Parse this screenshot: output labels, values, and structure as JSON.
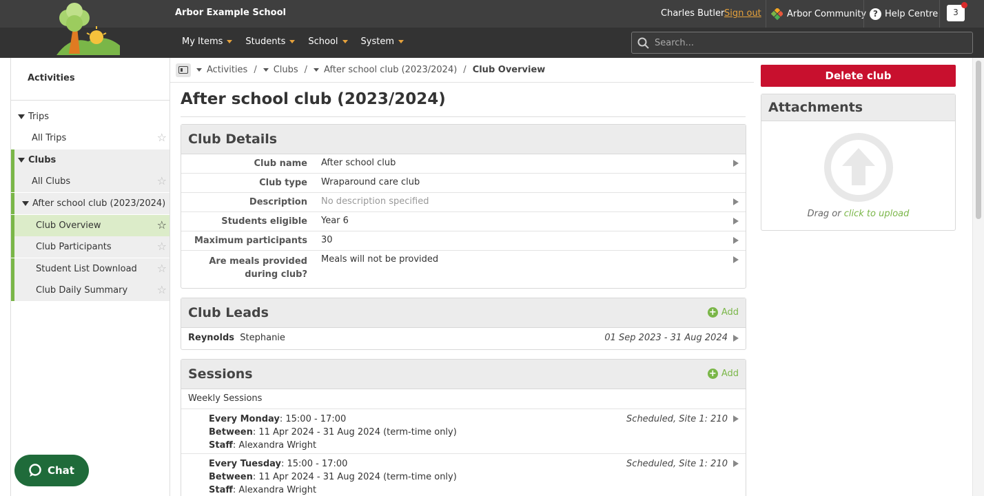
{
  "header": {
    "school_name": "Arbor Example School",
    "user_name": "Charles Butler",
    "sign_out": "Sign out",
    "community": "Arbor Community",
    "help": "Help Centre",
    "notification_count": "3",
    "nav": [
      "My Items",
      "Students",
      "School",
      "System"
    ],
    "search_placeholder": "Search..."
  },
  "sidebar": {
    "title": "Activities",
    "items": [
      {
        "label": "Trips"
      },
      {
        "label": "All Trips"
      },
      {
        "label": "Clubs"
      },
      {
        "label": "All Clubs"
      },
      {
        "label": "After school club (2023/2024)"
      },
      {
        "label": "Club Overview"
      },
      {
        "label": "Club Participants"
      },
      {
        "label": "Student List Download"
      },
      {
        "label": "Club Daily Summary"
      }
    ]
  },
  "breadcrumb": {
    "items": [
      "Activities",
      "Clubs",
      "After school club (2023/2024)"
    ],
    "current": "Club Overview"
  },
  "page": {
    "title": "After school club (2023/2024)"
  },
  "club_details": {
    "heading": "Club Details",
    "rows": [
      {
        "label": "Club name",
        "value": "After school club"
      },
      {
        "label": "Club type",
        "value": "Wraparound care club"
      },
      {
        "label": "Description",
        "value": "No description specified"
      },
      {
        "label": "Students eligible",
        "value": "Year 6"
      },
      {
        "label": "Maximum participants",
        "value": "30"
      },
      {
        "label": "Are meals provided during club?",
        "value": "Meals will not be provided"
      }
    ]
  },
  "club_leads": {
    "heading": "Club Leads",
    "add_label": "Add",
    "rows": [
      {
        "surname": "Reynolds",
        "forename": "Stephanie",
        "dates": "01 Sep 2023 - 31 Aug 2024"
      }
    ]
  },
  "sessions": {
    "heading": "Sessions",
    "add_label": "Add",
    "subheading": "Weekly Sessions",
    "rows": [
      {
        "day": "Every Monday",
        "time": ": 15:00 - 17:00",
        "between_label": "Between",
        "between": ": 11 Apr 2024 - 31 Aug 2024 (term-time only)",
        "staff_label": "Staff",
        "staff": ": Alexandra Wright",
        "meta": "Scheduled, Site 1: 210"
      },
      {
        "day": "Every Tuesday",
        "time": ": 15:00 - 17:00",
        "between_label": "Between",
        "between": ": 11 Apr 2024 - 31 Aug 2024 (term-time only)",
        "staff_label": "Staff",
        "staff": ": Alexandra Wright",
        "meta": "Scheduled, Site 1: 210"
      }
    ]
  },
  "right": {
    "delete_label": "Delete club",
    "attachments_heading": "Attachments",
    "drag_text": "Drag or",
    "upload_link": "click to upload"
  },
  "chat": {
    "label": "Chat"
  },
  "colors": {
    "brand_green": "#7ab648",
    "danger_red": "#c8102e",
    "header_dark": "#3f3f3f",
    "accent_orange": "#e6a23c"
  }
}
